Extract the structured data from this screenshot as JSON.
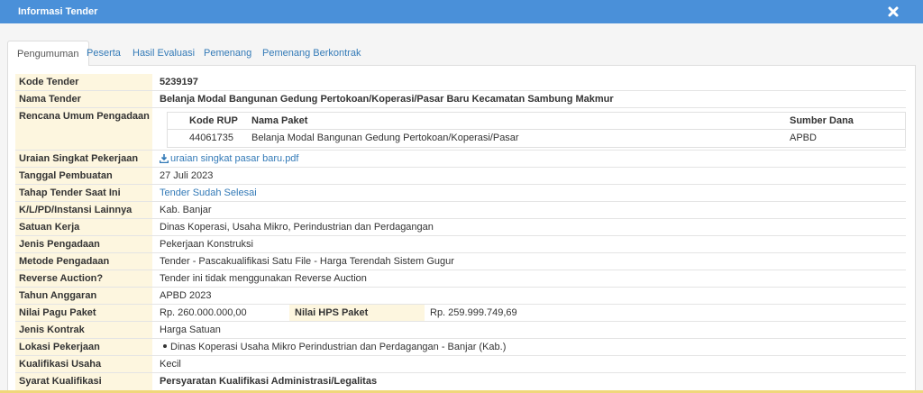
{
  "window": {
    "title": "Informasi Tender"
  },
  "tabs": [
    "Pengumuman",
    "Peserta",
    "Hasil Evaluasi",
    "Pemenang",
    "Pemenang Berkontrak"
  ],
  "fields": {
    "kode_tender": {
      "label": "Kode Tender",
      "value": "5239197"
    },
    "nama_tender": {
      "label": "Nama Tender",
      "value": "Belanja Modal Bangunan Gedung Pertokoan/Koperasi/Pasar Baru Kecamatan Sambung Makmur"
    },
    "rup": {
      "label": "Rencana Umum Pengadaan",
      "headers": [
        "Kode RUP",
        "Nama Paket",
        "Sumber Dana"
      ],
      "row": [
        "44061735",
        "Belanja Modal Bangunan Gedung Pertokoan/Koperasi/Pasar",
        "APBD"
      ]
    },
    "uraian": {
      "label": "Uraian Singkat Pekerjaan",
      "value": "uraian singkat pasar baru.pdf"
    },
    "tanggal": {
      "label": "Tanggal Pembuatan",
      "value": "27 Juli 2023"
    },
    "tahap": {
      "label": "Tahap Tender Saat Ini",
      "value": "Tender Sudah Selesai"
    },
    "klpd": {
      "label": "K/L/PD/Instansi Lainnya",
      "value": "Kab. Banjar"
    },
    "satker": {
      "label": "Satuan Kerja",
      "value": "Dinas Koperasi, Usaha Mikro, Perindustrian dan Perdagangan"
    },
    "jenis_pengadaan": {
      "label": "Jenis Pengadaan",
      "value": "Pekerjaan Konstruksi"
    },
    "metode": {
      "label": "Metode Pengadaan",
      "value": "Tender - Pascakualifikasi Satu File - Harga Terendah Sistem Gugur"
    },
    "reverse": {
      "label": "Reverse Auction?",
      "value": "Tender ini tidak menggunakan Reverse Auction"
    },
    "tahun": {
      "label": "Tahun Anggaran",
      "value": "APBD 2023"
    },
    "pagu": {
      "label": "Nilai Pagu Paket",
      "value": "Rp. 260.000.000,00",
      "hps_label": "Nilai HPS Paket",
      "hps_value": "Rp. 259.999.749,69"
    },
    "kontrak": {
      "label": "Jenis Kontrak",
      "value": "Harga Satuan"
    },
    "lokasi": {
      "label": "Lokasi Pekerjaan",
      "value": "Dinas Koperasi Usaha Mikro Perindustrian dan Perdagangan - Banjar (Kab.)"
    },
    "kualifikasi": {
      "label": "Kualifikasi Usaha",
      "value": "Kecil"
    },
    "syarat": {
      "label": "Syarat Kualifikasi",
      "value": "Persyaratan Kualifikasi Administrasi/Legalitas"
    }
  },
  "colors": {
    "titlebar": "#4a90d9",
    "label_bg": "#fdf6df",
    "link": "#337ab7"
  }
}
